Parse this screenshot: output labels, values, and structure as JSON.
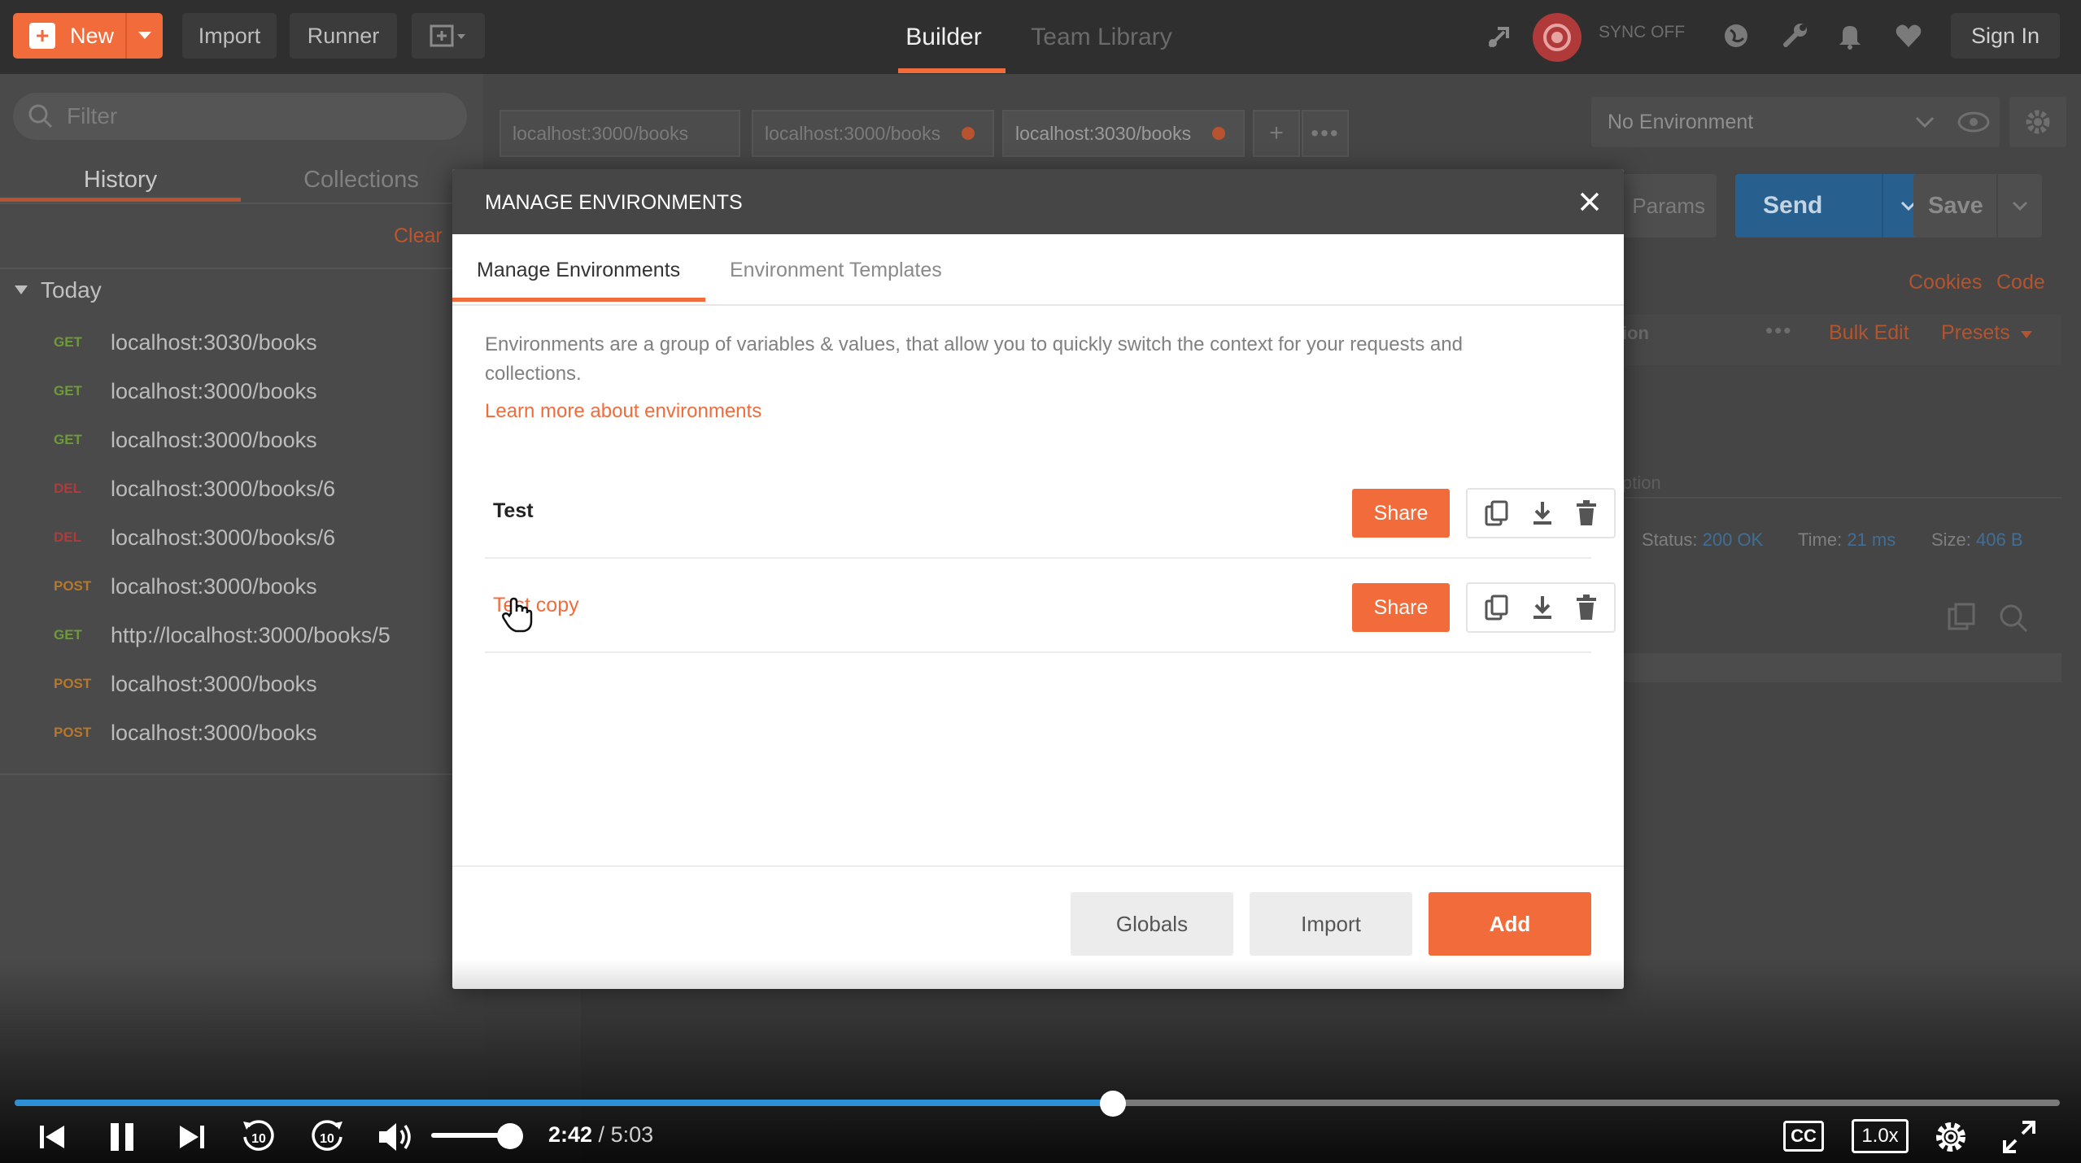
{
  "topbar": {
    "new_label": "New",
    "import_label": "Import",
    "runner_label": "Runner",
    "tabs": [
      {
        "label": "Builder"
      },
      {
        "label": "Team Library"
      }
    ],
    "sync_label": "SYNC OFF",
    "signin_label": "Sign In"
  },
  "sidebar": {
    "filter_placeholder": "Filter",
    "tabs": [
      {
        "label": "History"
      },
      {
        "label": "Collections"
      }
    ],
    "clear_label": "Clear",
    "group_label": "Today",
    "history": [
      {
        "method": "GET",
        "url": "localhost:3030/books"
      },
      {
        "method": "GET",
        "url": "localhost:3000/books"
      },
      {
        "method": "GET",
        "url": "localhost:3000/books"
      },
      {
        "method": "DEL",
        "url": "localhost:3000/books/6"
      },
      {
        "method": "DEL",
        "url": "localhost:3000/books/6"
      },
      {
        "method": "POST",
        "url": "localhost:3000/books"
      },
      {
        "method": "GET",
        "url": "http://localhost:3000/books/5"
      },
      {
        "method": "POST",
        "url": "localhost:3000/books"
      },
      {
        "method": "POST",
        "url": "localhost:3000/books"
      }
    ]
  },
  "request_tabs": [
    {
      "label": "localhost:3000/books"
    },
    {
      "label": "localhost:3000/books"
    },
    {
      "label": "localhost:3030/books"
    }
  ],
  "environment": {
    "selected": "No Environment"
  },
  "request": {
    "params_label": "Params",
    "send_label": "Send",
    "save_label": "Save",
    "cookies_label": "Cookies",
    "code_label": "Code",
    "bulk_edit_label": "Bulk Edit",
    "presets_label": "Presets",
    "col_fragment": "ion",
    "placeholder_fragment": "ption",
    "status_label": "Status:",
    "status_value": "200 OK",
    "time_label": "Time:",
    "time_value": "21 ms",
    "size_label": "Size:",
    "size_value": "406 B"
  },
  "modal": {
    "title": "MANAGE ENVIRONMENTS",
    "tabs": [
      {
        "label": "Manage Environments"
      },
      {
        "label": "Environment Templates"
      }
    ],
    "description": "Environments are a group of variables & values, that allow you to quickly switch the context for your requests and collections.",
    "learn_more": "Learn more about environments",
    "environments": [
      {
        "name": "Test",
        "share_label": "Share"
      },
      {
        "name": "Test copy",
        "share_label": "Share"
      }
    ],
    "globals_label": "Globals",
    "import_label": "Import",
    "add_label": "Add"
  },
  "player": {
    "current_time": "2:42",
    "separator": " / ",
    "total_time": "5:03",
    "progress": 0.537,
    "volume": 0.8,
    "cc_label": "CC",
    "speed_label": "1.0x"
  },
  "colors": {
    "accent": "#f26b3a",
    "send_blue": "#1c75bc",
    "progress_blue": "#2d8fd6"
  }
}
